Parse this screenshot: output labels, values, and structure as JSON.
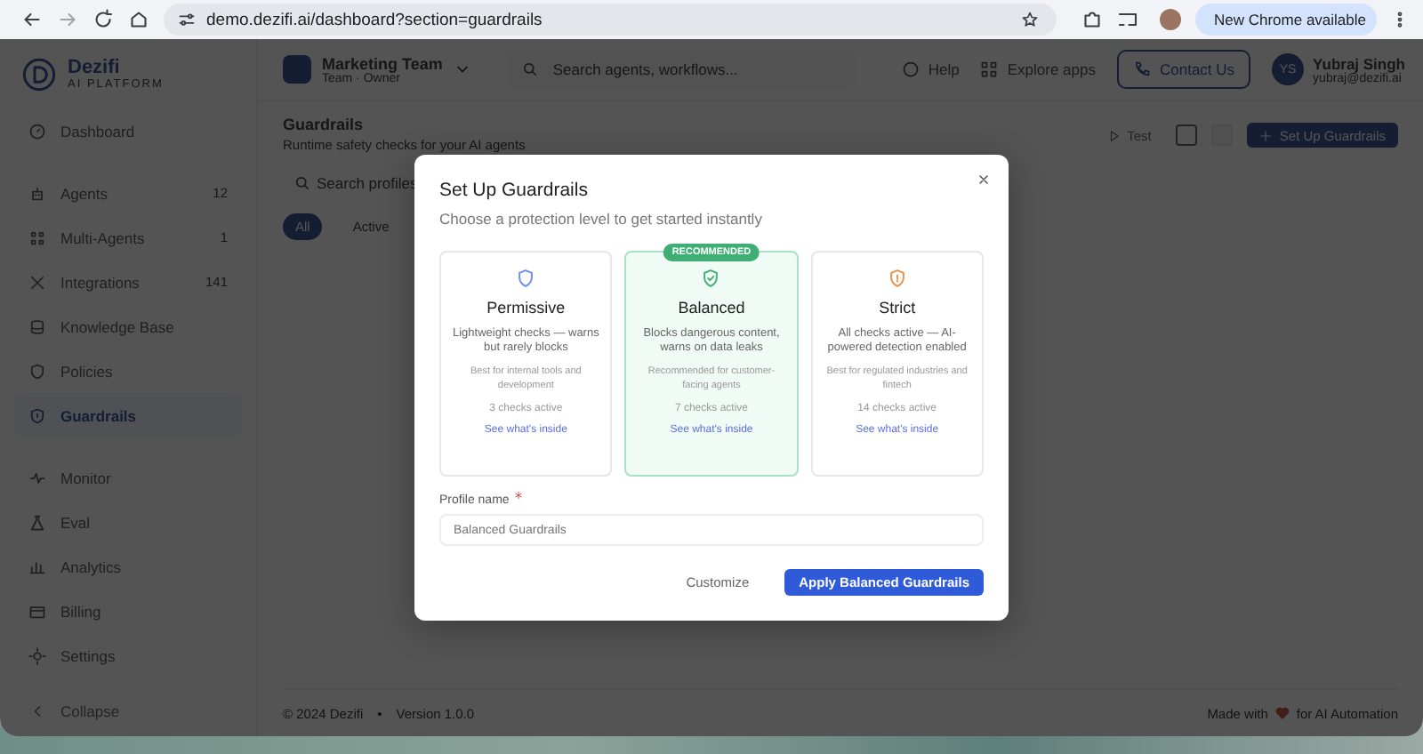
{
  "browser": {
    "url": "demo.dezifi.ai/dashboard?section=guardrails",
    "update_button": "New Chrome available"
  },
  "app": {
    "brand": {
      "name": "Dezifi",
      "tagline": "AI PLATFORM"
    },
    "team": {
      "name": "Marketing Team",
      "role": "Team · Owner"
    },
    "search": {
      "placeholder": "Search agents, workflows..."
    },
    "header_links": [
      "Help",
      "Explore apps"
    ],
    "contact_button": "Contact Us",
    "user": {
      "initials": "YS",
      "name": "Yubraj Singh",
      "email": "yubraj@dezifi.ai"
    }
  },
  "sidebar": {
    "groups": [
      [
        {
          "label": "Dashboard",
          "selected": false
        }
      ],
      [
        {
          "label": "Agents",
          "count": "12",
          "selected": false
        },
        {
          "label": "Multi-Agents",
          "count": "1",
          "selected": false
        },
        {
          "label": "Integrations",
          "count": "141",
          "selected": false
        },
        {
          "label": "Knowledge Base",
          "selected": false
        },
        {
          "label": "Policies",
          "selected": false
        },
        {
          "label": "Guardrails",
          "selected": true
        }
      ],
      [
        {
          "label": "Monitor",
          "selected": false
        },
        {
          "label": "Eval",
          "selected": false
        },
        {
          "label": "Analytics",
          "selected": false
        },
        {
          "label": "Billing",
          "selected": false
        },
        {
          "label": "Settings",
          "selected": false
        }
      ]
    ],
    "collapse": "Collapse"
  },
  "page": {
    "title": "Guardrails",
    "subtitle": "Runtime safety checks for your AI agents",
    "test_button": "Test",
    "setup_button": "Set Up Guardrails",
    "search": {
      "placeholder": "Search profiles"
    },
    "views": [
      {
        "selected": true
      },
      {
        "selected": false
      }
    ],
    "filters": [
      {
        "label": "All",
        "selected": true
      },
      {
        "label": "Active",
        "selected": false
      }
    ]
  },
  "footer": {
    "copyright": "© 2024 Dezifi",
    "separator": "•",
    "version": "Version 1.0.0",
    "made_with": "Made with",
    "made_for": "for AI Automation"
  },
  "modal": {
    "title": "Set Up Guardrails",
    "subtitle": "Choose a protection level to get started instantly",
    "options": [
      {
        "name": "Permissive",
        "description": "Lightweight checks — warns but rarely blocks",
        "best_for": "Best for internal tools and development",
        "checks": "3 checks active",
        "link": "See what's inside",
        "selected": false,
        "color": "#6b8cf0"
      },
      {
        "name": "Balanced",
        "badge": "RECOMMENDED",
        "description": "Blocks dangerous content, warns on data leaks",
        "best_for": "Recommended for customer-facing agents",
        "checks": "7 checks active",
        "link": "See what's inside",
        "selected": true,
        "color": "#3fae74"
      },
      {
        "name": "Strict",
        "description": "All checks active — AI-powered detection enabled",
        "best_for": "Best for regulated industries and fintech",
        "checks": "14 checks active",
        "link": "See what's inside",
        "selected": false,
        "color": "#e8904a"
      }
    ],
    "profile": {
      "label": "Profile name",
      "required": true,
      "placeholder": "Balanced Guardrails"
    },
    "customize_button": "Customize",
    "apply_button": "Apply Balanced Guardrails"
  }
}
